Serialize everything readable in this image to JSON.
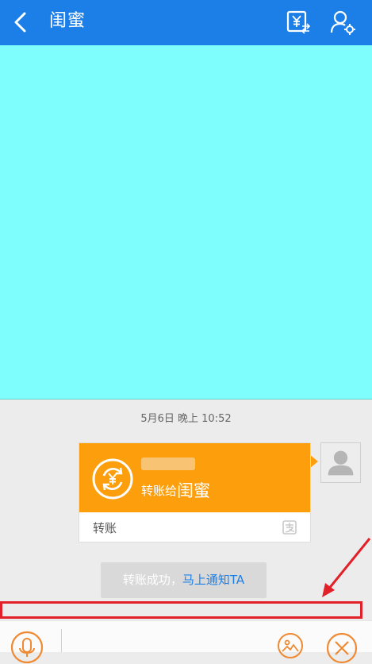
{
  "header": {
    "title": "闺蜜",
    "back_icon": "chevron-left-icon",
    "transfer_icon": "yuan-transfer-icon",
    "profile_icon": "user-settings-icon",
    "bar_color": "#1c7fe8"
  },
  "chat": {
    "timestamp": "5月6日 晚上 10:52",
    "transfer_card": {
      "prefix": "转账给",
      "recipient": "闺蜜",
      "footer_label": "转账",
      "accent_color": "#fd9e0c"
    },
    "system_message": {
      "text": "转账成功，",
      "link": "马上通知TA"
    }
  },
  "input_bar": {
    "voice_icon": "microphone-icon",
    "image_icon": "image-icon",
    "more_icon": "close-circle-icon",
    "input_value": ""
  },
  "annotation": {
    "color": "#e2202a"
  }
}
